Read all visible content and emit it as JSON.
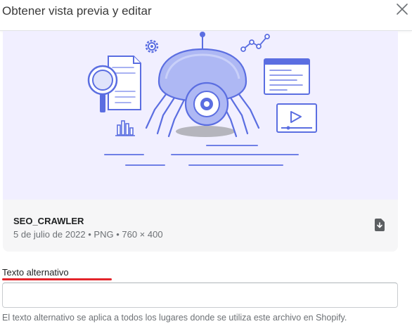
{
  "modal": {
    "title": "Obtener vista previa y editar",
    "close_icon": "close-icon"
  },
  "preview": {
    "illustration": "seo-crawler-spider-robot-illustration",
    "background_color": "#f1efff",
    "accent_color": "#5b6ee1",
    "file_name": "SEO_CRAWLER",
    "file_meta": "5 de julio de 2022 • PNG • 760 × 400",
    "download_icon": "download-file-icon"
  },
  "alt_text": {
    "label": "Texto alternativo",
    "value": "",
    "placeholder": "",
    "help": "El texto alternativo se aplica a todos los lugares donde se utiliza este archivo en Shopify."
  },
  "colors": {
    "annotation_underline": "#e3242b"
  }
}
